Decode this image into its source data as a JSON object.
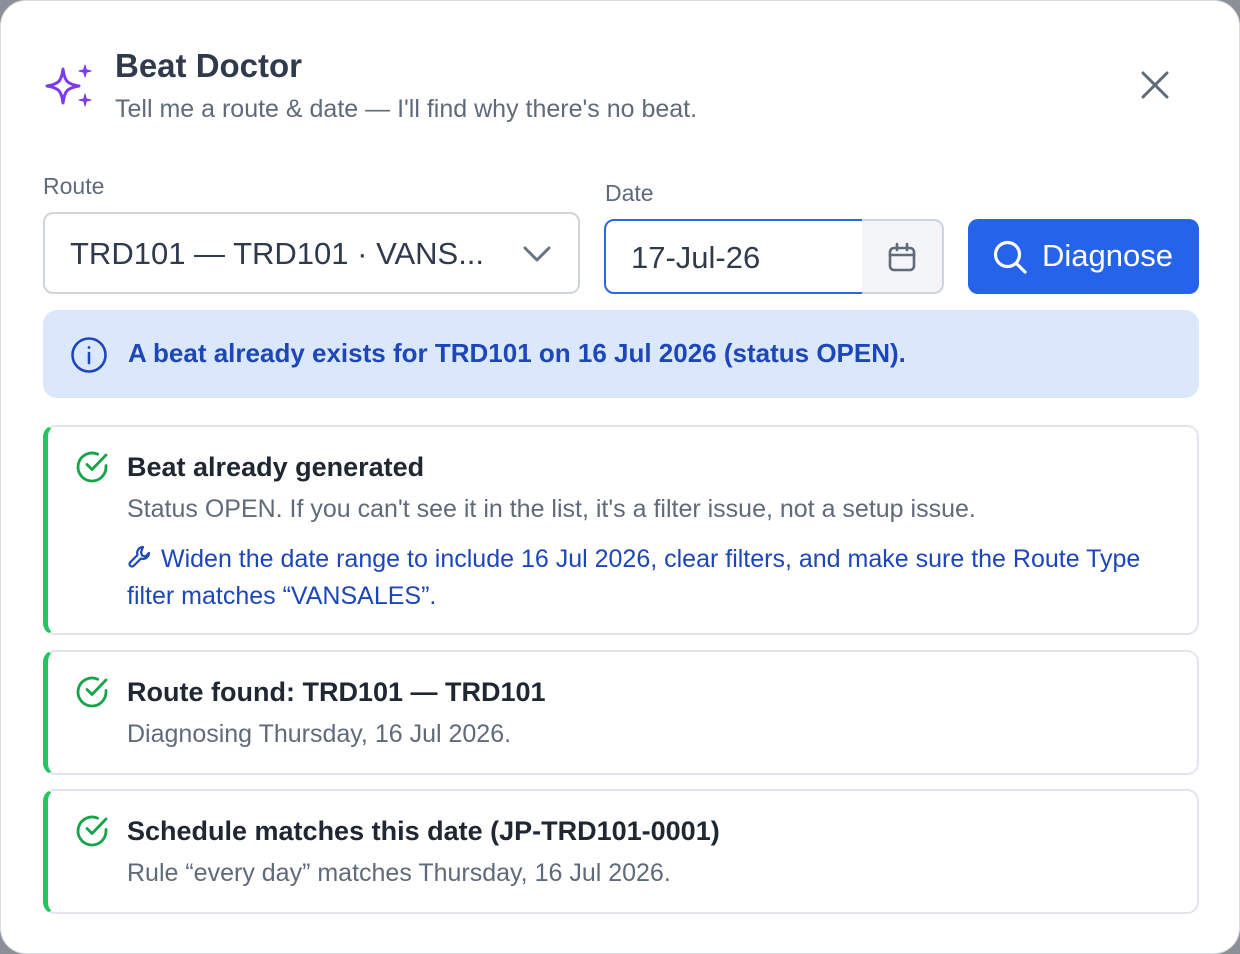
{
  "header": {
    "title": "Beat Doctor",
    "subtitle": "Tell me a route & date — I'll find why there's no beat."
  },
  "form": {
    "route_label": "Route",
    "route_value": "TRD101 — TRD101 · VANS...",
    "date_label": "Date",
    "date_value": "17-Jul-26",
    "diagnose_label": "Diagnose"
  },
  "info": {
    "message": "A beat already exists for TRD101 on 16 Jul 2026 (status OPEN)."
  },
  "checks": [
    {
      "title": "Beat already generated",
      "description": "Status OPEN. If you can't see it in the list, it's a filter issue, not a setup issue.",
      "fix": "Widen the date range to include 16 Jul 2026, clear filters, and make sure the Route Type filter matches “VANSALES”."
    },
    {
      "title": "Route found: TRD101 — TRD101",
      "description": "Diagnosing Thursday, 16 Jul 2026."
    },
    {
      "title": "Schedule matches this date (JP-TRD101-0001)",
      "description": "Rule “every day” matches Thursday, 16 Jul 2026."
    }
  ],
  "colors": {
    "accent": "#2563eb",
    "sparkle": "#7c3aed",
    "success": "#22c55e",
    "info_bg": "#dbe8fb",
    "info_text": "#1d47b8"
  },
  "icons": {
    "header": "sparkles-icon",
    "close": "close-icon",
    "route_dropdown": "chevron-down-icon",
    "date_picker": "calendar-icon",
    "diagnose": "search-icon",
    "info": "info-icon",
    "check": "check-circle-icon",
    "fix": "wrench-icon"
  }
}
